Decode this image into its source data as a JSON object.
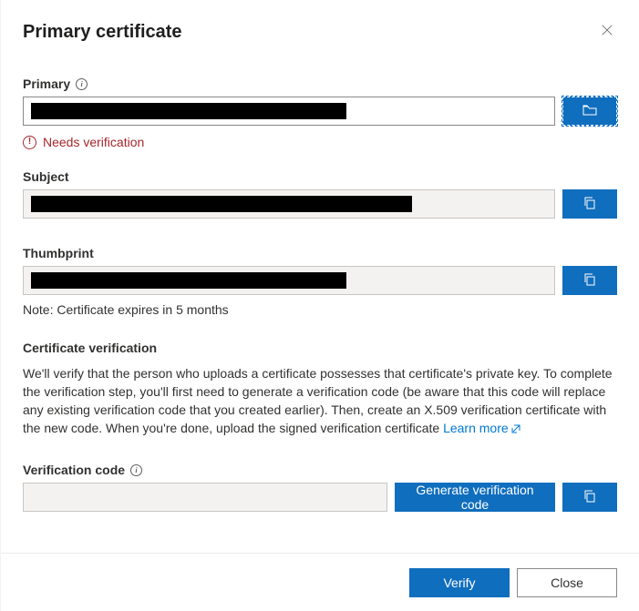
{
  "header": {
    "title": "Primary certificate"
  },
  "primary": {
    "label": "Primary",
    "value": "████████████████████████████████████",
    "status": "Needs verification"
  },
  "subject": {
    "label": "Subject",
    "value": "████████████████████████████████████████████"
  },
  "thumbprint": {
    "label": "Thumbprint",
    "value": "████████████████████████████████████"
  },
  "note": {
    "prefix": "Note:",
    "text": "Certificate expires in 5 months"
  },
  "verification": {
    "heading": "Certificate verification",
    "description": "We'll verify that the person who uploads a certificate possesses that certificate's private key. To complete the verification step, you'll first need to generate a verification code (be aware that this code will replace any existing verification code that you created earlier). Then, create an X.509 verification certificate with the new code. When you're done, upload the signed verification certificate ",
    "learn_more": "Learn more"
  },
  "verification_code": {
    "label": "Verification code",
    "value": "",
    "generate_label": "Generate verification code"
  },
  "footer": {
    "verify_label": "Verify",
    "close_label": "Close"
  },
  "icons": {
    "copy": "copy",
    "open_folder": "open-folder",
    "error": "!",
    "info": "i"
  },
  "colors": {
    "accent": "#106ebe",
    "error": "#a4262c",
    "link": "#0078d4"
  }
}
